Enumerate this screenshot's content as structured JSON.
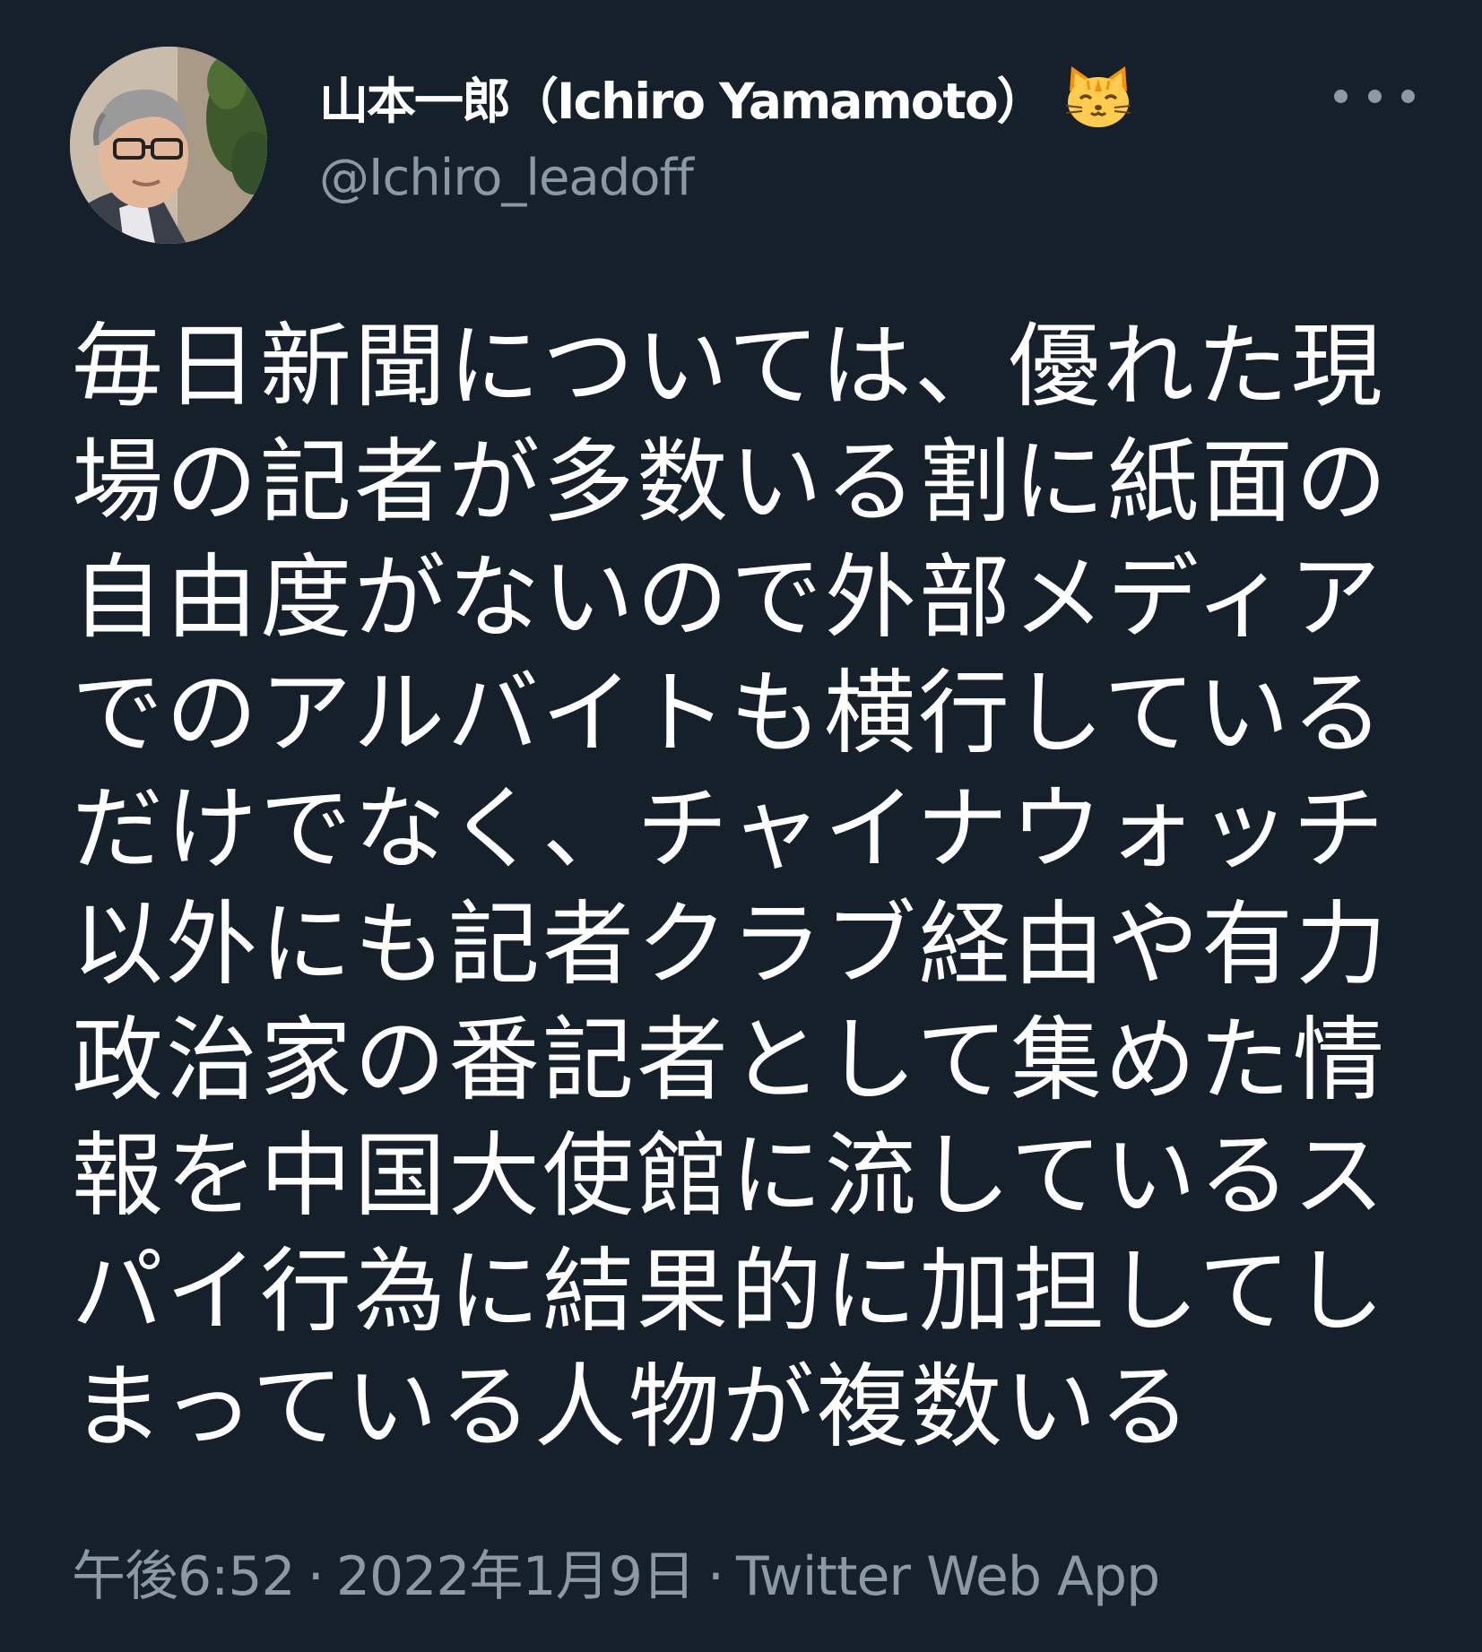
{
  "user": {
    "display_name": "山本一郎（Ichiro Yamamoto）",
    "name_emoji": "cat-face-icon",
    "handle": "@Ichiro_leadoff",
    "avatar": "avatar-photo"
  },
  "more_menu": {
    "icon": "more-horizontal-icon"
  },
  "tweet": {
    "lines": [
      "毎日新聞については、優れた現",
      "場の記者が多数いる割に紙面の",
      "自由度がないので外部メディア",
      "でのアルバイトも横行している",
      "だけでなく、チャイナウォッチ",
      "以外にも記者クラブ経由や有力",
      "政治家の番記者として集めた情",
      "報を中国大使館に流しているス",
      "パイ行為に結果的に加担してし",
      "まっている人物が複数いる"
    ]
  },
  "meta": {
    "time": "午後6:52",
    "separator": "·",
    "date": "2022年1月9日",
    "source": "Twitter Web App"
  },
  "colors": {
    "background": "#15202b",
    "text": "#ffffff",
    "secondary": "#8b98a5"
  }
}
